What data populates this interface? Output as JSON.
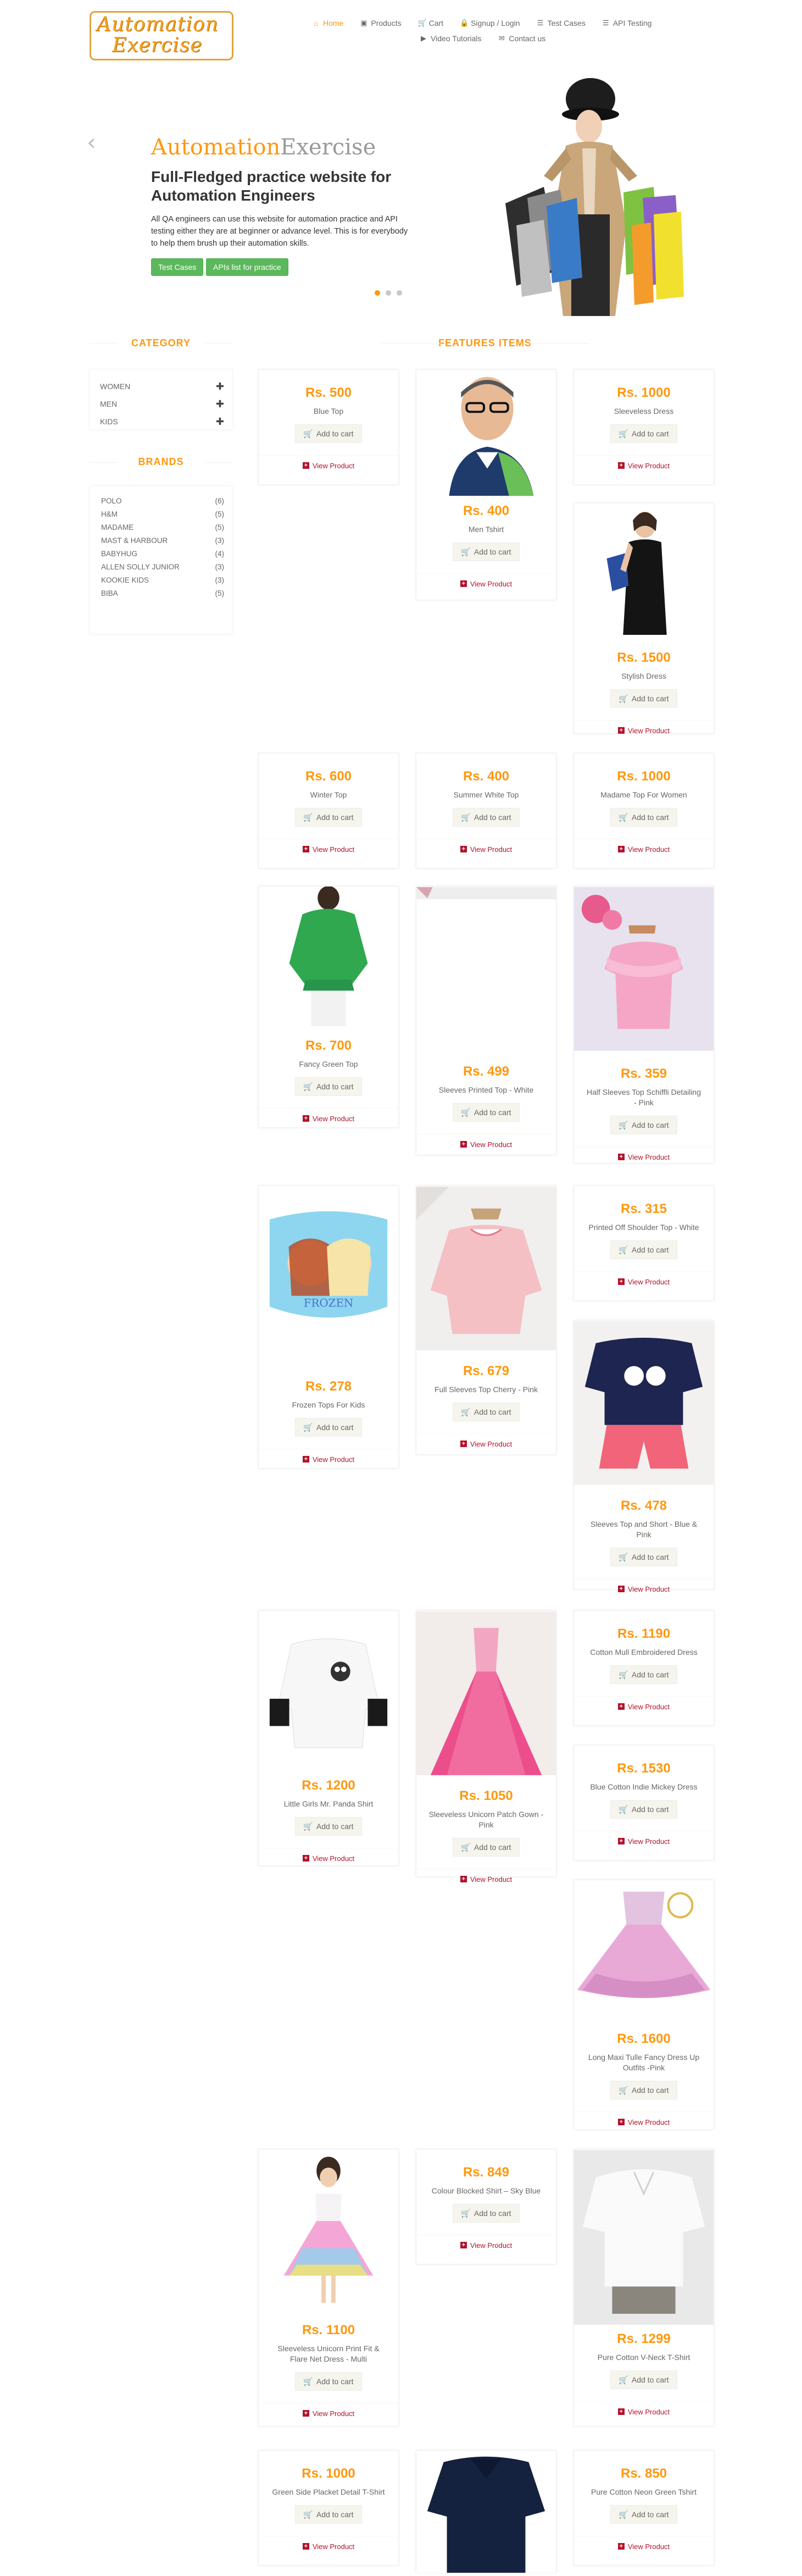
{
  "logo": {
    "line1": "Automation",
    "line2": "Exercise"
  },
  "nav": [
    {
      "label": "Home",
      "icon": "home-icon",
      "glyph": "⌂",
      "active": true
    },
    {
      "label": "Products",
      "icon": "products-icon",
      "glyph": "▣",
      "active": false
    },
    {
      "label": "Cart",
      "icon": "cart-icon",
      "glyph": "🛒",
      "active": false
    },
    {
      "label": "Signup / Login",
      "icon": "lock-icon",
      "glyph": "🔒",
      "active": false
    },
    {
      "label": "Test Cases",
      "icon": "list-icon",
      "glyph": "☰",
      "active": false
    },
    {
      "label": "API Testing",
      "icon": "list-icon",
      "glyph": "☰",
      "active": false
    },
    {
      "label": "Video Tutorials",
      "icon": "youtube-icon",
      "glyph": "▶",
      "active": false
    },
    {
      "label": "Contact us",
      "icon": "envelope-icon",
      "glyph": "✉",
      "active": false
    }
  ],
  "hero": {
    "brand_a": "Automation",
    "brand_b": "Exercise",
    "title": "Full-Fledged practice website for Automation Engineers",
    "description": "All QA engineers can use this website for automation practice and API testing either they are at beginner or advance level. This is for everybody to help them brush up their automation skills.",
    "btn_test_cases": "Test Cases",
    "btn_apis": "APIs list for practice",
    "prev": "‹",
    "next": "›"
  },
  "sidebar": {
    "category_title": "CATEGORY",
    "categories": [
      "Women",
      "Men",
      "Kids"
    ],
    "brands_title": "BRANDS",
    "brands": [
      {
        "name": "Polo",
        "count": "(6)"
      },
      {
        "name": "H&M",
        "count": "(5)"
      },
      {
        "name": "Madame",
        "count": "(5)"
      },
      {
        "name": "Mast & Harbour",
        "count": "(3)"
      },
      {
        "name": "Babyhug",
        "count": "(4)"
      },
      {
        "name": "Allen Solly Junior",
        "count": "(3)"
      },
      {
        "name": "Kookie Kids",
        "count": "(3)"
      },
      {
        "name": "Biba",
        "count": "(5)"
      }
    ]
  },
  "features_title": "FEATURES ITEMS",
  "add_to_cart": "Add to cart",
  "view_product": "View Product",
  "products": [
    {
      "price": "Rs. 500",
      "name": "Blue Top"
    },
    {
      "price": "Rs. 400",
      "name": "Men Tshirt"
    },
    {
      "price": "Rs. 1000",
      "name": "Sleeveless Dress"
    },
    {
      "price": "Rs. 1500",
      "name": "Stylish Dress"
    },
    {
      "price": "Rs. 600",
      "name": "Winter Top"
    },
    {
      "price": "Rs. 400",
      "name": "Summer White Top"
    },
    {
      "price": "Rs. 1000",
      "name": "Madame Top For Women"
    },
    {
      "price": "Rs. 700",
      "name": "Fancy Green Top"
    },
    {
      "price": "Rs. 499",
      "name": "Sleeves Printed Top - White"
    },
    {
      "price": "Rs. 359",
      "name": "Half Sleeves Top Schiffli Detailing - Pink"
    },
    {
      "price": "Rs. 278",
      "name": "Frozen Tops For Kids"
    },
    {
      "price": "Rs. 679",
      "name": "Full Sleeves Top Cherry - Pink"
    },
    {
      "price": "Rs. 315",
      "name": "Printed Off Shoulder Top - White"
    },
    {
      "price": "Rs. 478",
      "name": "Sleeves Top and Short - Blue & Pink"
    },
    {
      "price": "Rs. 1200",
      "name": "Little Girls Mr. Panda Shirt"
    },
    {
      "price": "Rs. 1050",
      "name": "Sleeveless Unicorn Patch Gown - Pink"
    },
    {
      "price": "Rs. 1190",
      "name": "Cotton Mull Embroidered Dress"
    },
    {
      "price": "Rs. 1530",
      "name": "Blue Cotton Indie Mickey Dress"
    },
    {
      "price": "Rs. 1600",
      "name": "Long Maxi Tulle Fancy Dress Up Outfits -Pink"
    },
    {
      "price": "Rs. 1100",
      "name": "Sleeveless Unicorn Print Fit & Flare Net Dress - Multi"
    },
    {
      "price": "Rs. 849",
      "name": "Colour Blocked Shirt – Sky Blue"
    },
    {
      "price": "Rs. 1299",
      "name": "Pure Cotton V-Neck T-Shirt"
    },
    {
      "price": "Rs. 1000",
      "name": "Green Side Placket Detail T-Shirt"
    },
    {
      "price": "Rs. 850",
      "name": "Pure Cotton Neon Green Tshirt"
    }
  ]
}
